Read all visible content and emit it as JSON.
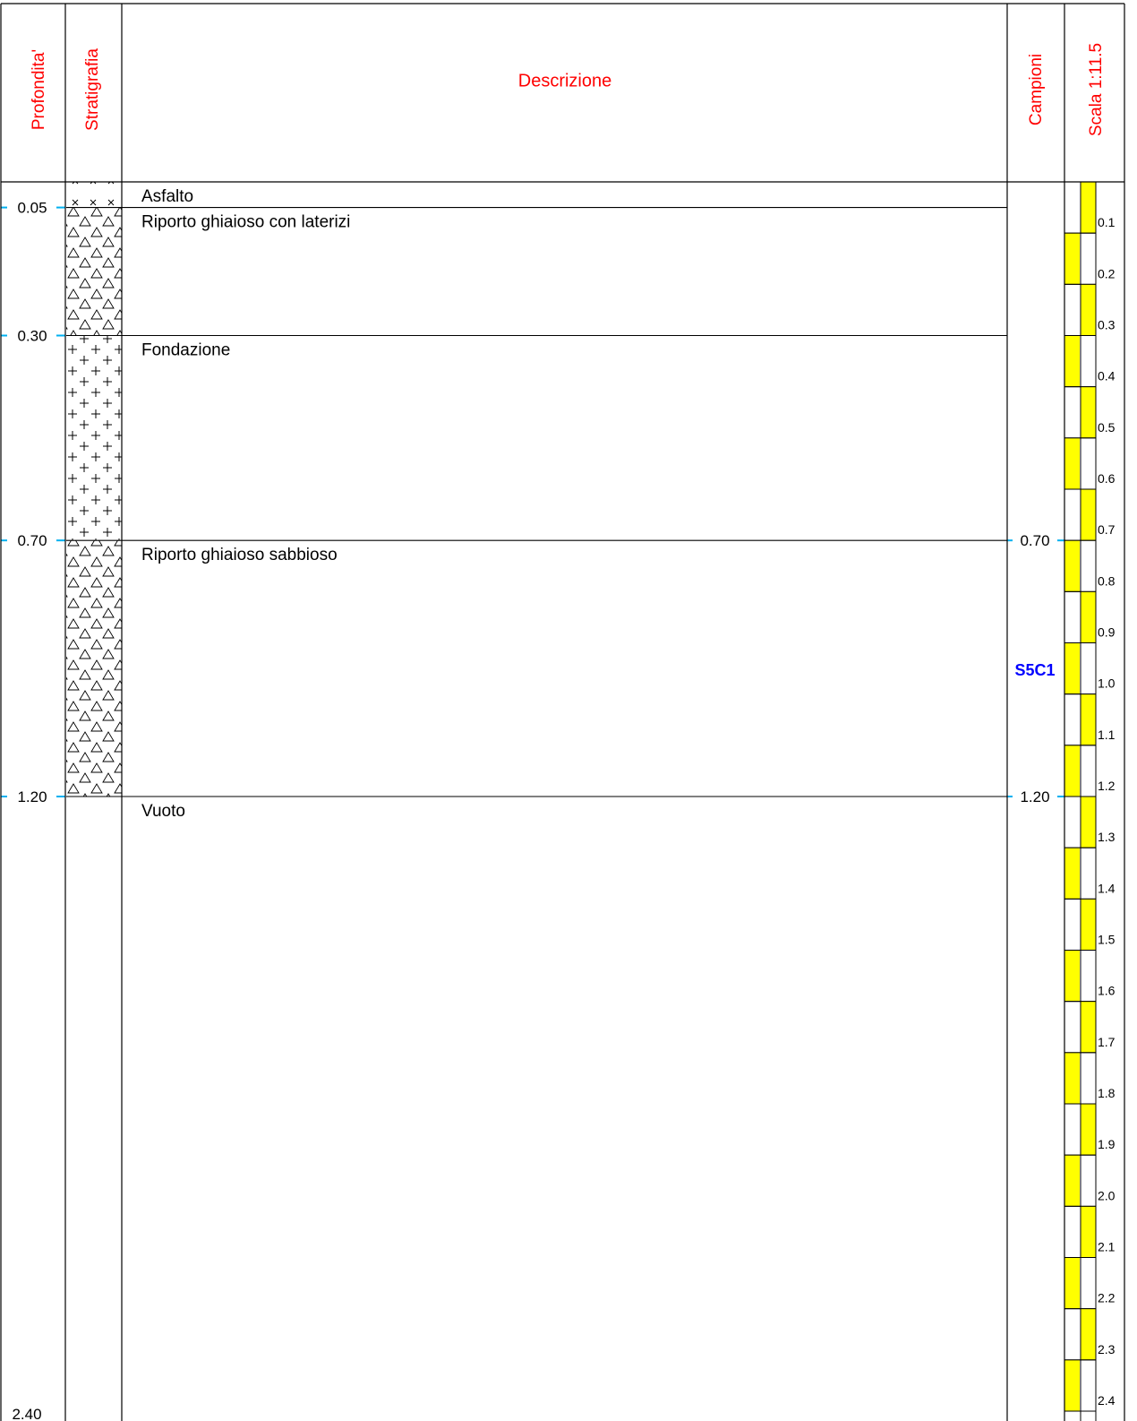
{
  "headers": {
    "depth": "Profondita'",
    "strat": "Stratigrafia",
    "desc": "Descrizione",
    "samples": "Campioni",
    "scale": "Scala 1:11.5"
  },
  "header_color": "#ff0000",
  "sample_color": "#0000ff",
  "scale_fill_color": "#ffff00",
  "depth_marker_color": "#00b0f0",
  "depth_bottom": 2.4,
  "bottom_label": "2.40",
  "layers": [
    {
      "top": 0.0,
      "bottom": 0.05,
      "depth_label": "0.05",
      "description": "Asfalto",
      "pattern": "crosses-x"
    },
    {
      "top": 0.05,
      "bottom": 0.3,
      "depth_label": "0.30",
      "description": "Riporto ghiaioso con laterizi",
      "pattern": "triangles"
    },
    {
      "top": 0.3,
      "bottom": 0.7,
      "depth_label": "0.70",
      "description": "Fondazione",
      "pattern": "plus"
    },
    {
      "top": 0.7,
      "bottom": 1.2,
      "depth_label": "1.20",
      "description": "Riporto ghiaioso sabbioso",
      "pattern": "triangles"
    },
    {
      "top": 1.2,
      "bottom": 2.4,
      "depth_label": "",
      "description": "Vuoto",
      "pattern": "none"
    }
  ],
  "samples": [
    {
      "id": "S5C1",
      "top": 0.7,
      "bottom": 1.2,
      "top_label": "0.70",
      "bottom_label": "1.20"
    }
  ],
  "scale_ticks": [
    "0.1",
    "0.2",
    "0.3",
    "0.4",
    "0.5",
    "0.6",
    "0.7",
    "0.8",
    "0.9",
    "1.0",
    "1.1",
    "1.2",
    "1.3",
    "1.4",
    "1.5",
    "1.6",
    "1.7",
    "1.8",
    "1.9",
    "2.0",
    "2.1",
    "2.2",
    "2.3",
    "2.4"
  ]
}
